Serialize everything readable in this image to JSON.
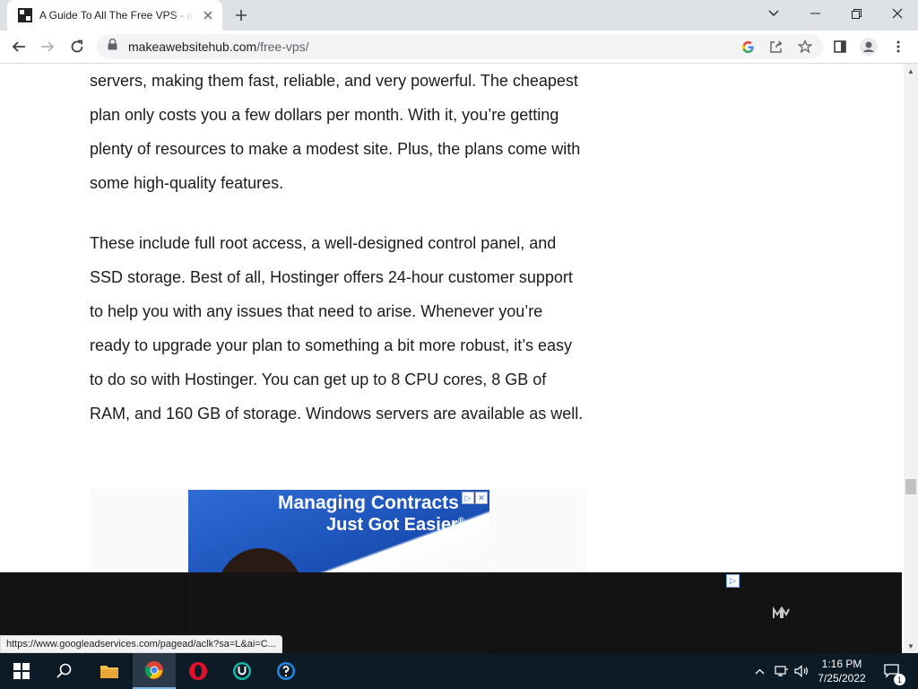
{
  "browser": {
    "tab_title": "A Guide To All The Free VPS - and",
    "url_domain": "makeawebsitehub.com",
    "url_path": "/free-vps/",
    "status_url": "https://www.googleadservices.com/pagead/aclk?sa=L&ai=C..."
  },
  "article": {
    "paragraph1": "servers, making them fast, reliable, and very powerful. The cheapest plan only costs you a few dollars per month. With it, you’re getting plenty of resources to make a modest site. Plus, the plans come with some high-quality features.",
    "paragraph2": "These include full root access, a well-designed control panel, and SSD storage. Best of all, Hostinger offers 24-hour customer support to help you with any issues that need to arise. Whenever you’re ready to upgrade your plan to something a bit more robust, it’s easy to do so with Hostinger. You can get up to 8 CPU cores, 8 GB of RAM, and 160 GB of storage. Windows servers are available as well."
  },
  "ad": {
    "headline1": "Managing Contracts",
    "headline2": "Just Got Easier",
    "registered_mark": "®"
  },
  "taskbar": {
    "time": "1:16 PM",
    "date": "7/25/2022",
    "notification_count": "1"
  }
}
